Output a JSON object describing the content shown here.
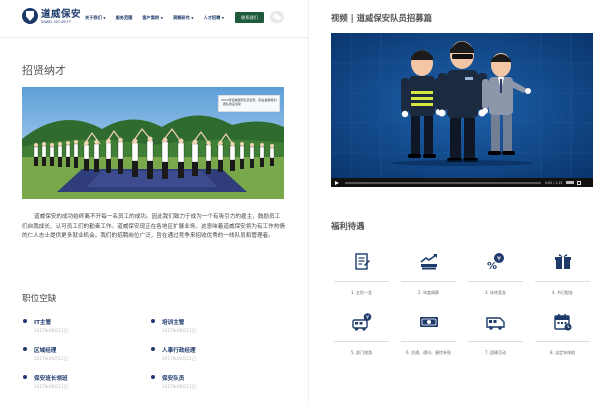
{
  "header": {
    "logo_cn": "道威保安",
    "logo_en": "DAWEI SECURITY",
    "nav": [
      {
        "label": "关于我们",
        "dropdown": true
      },
      {
        "label": "服务范围",
        "dropdown": false
      },
      {
        "label": "客户案例",
        "dropdown": true
      },
      {
        "label": "洞察研究",
        "dropdown": true
      },
      {
        "label": "人才招聘",
        "dropdown": true
      }
    ],
    "cta_label": "联系我们"
  },
  "recruit": {
    "title": "招贤纳才",
    "photo_caption": "2019年道威保安队员合影 · 职业发展培训 · 团队建设活动",
    "intro": "道威保安的成功始终离不开每一名员工的成功。因此我们致力于成为一个有吸引力的雇主，鼓励员工们自我成长、认可员工们的勤奋工作。道威保安现正在各地区扩展业务。这意味着道威保安将为有工作热情的仁人志士提供更多就业机会。我们的招聘岗位广泛，旨在通过竞争来招收优秀的一线队员和管理者。"
  },
  "jobs": {
    "title": "职位空缺",
    "items": [
      {
        "name": "IT主管",
        "date": "2017年09月12日"
      },
      {
        "name": "培训主管",
        "date": "2017年09月12日"
      },
      {
        "name": "区域经理",
        "date": "2017年09月12日"
      },
      {
        "name": "人事行政经理",
        "date": "2017年09月12日"
      },
      {
        "name": "保安班长领班",
        "date": "2017年09月12日"
      },
      {
        "name": "保安队员",
        "date": "2017年09月12日"
      }
    ]
  },
  "video": {
    "title": "视频 | 道威保安队员招募篇",
    "timecode": "0:00 / 1:15",
    "progress": 0
  },
  "welfare": {
    "title": "福利待遇",
    "items": [
      {
        "label": "1. 五险一金",
        "icon": "document-icon"
      },
      {
        "label": "2. 年度调薪",
        "icon": "rising-chart-icon"
      },
      {
        "label": "3. 年终奖金",
        "icon": "yuan-percent-icon"
      },
      {
        "label": "4. 节日慰金",
        "icon": "gift-box-icon"
      },
      {
        "label": "5. 部门旅游",
        "icon": "bus-yuan-icon"
      },
      {
        "label": "6. 交通、通讯、餐饮补贴",
        "icon": "banknote-icon"
      },
      {
        "label": "7. 团建活动",
        "icon": "van-icon"
      },
      {
        "label": "8. 法定年休假",
        "icon": "calendar-icon"
      }
    ]
  },
  "colors": {
    "brand": "#1d3a6b",
    "cta": "#1f5a3a",
    "video_bg": "#0b3d7c"
  }
}
